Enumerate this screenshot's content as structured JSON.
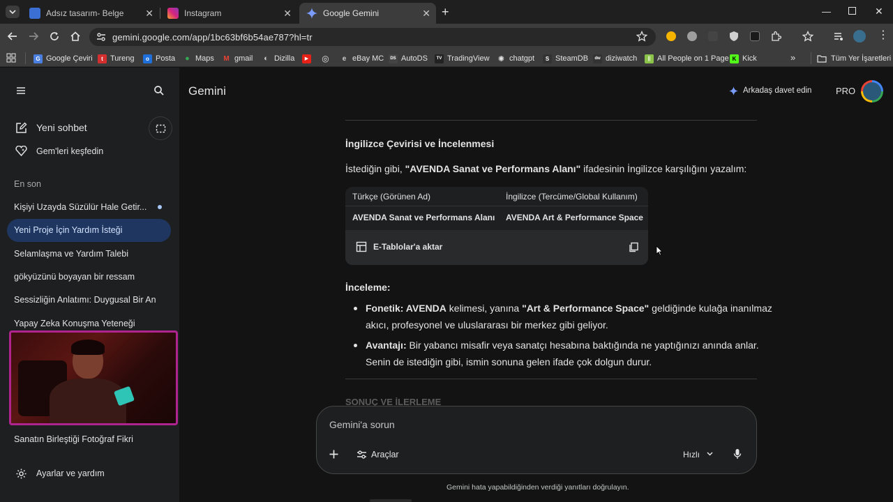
{
  "browser": {
    "tabs": [
      {
        "title": "Adsız tasarım- Belge",
        "fav_color": "#3b6fd4"
      },
      {
        "title": "Instagram",
        "fav_color": "#d6247d"
      },
      {
        "title": "Google Gemini",
        "fav_color": "#6f8ff0"
      }
    ],
    "url": "gemini.google.com/app/1bc63bf6b54ae787?hl=tr",
    "bookmarks": [
      {
        "label": "Google Çeviri",
        "color": "#4a7fe0",
        "glyph": "G"
      },
      {
        "label": "Tureng",
        "color": "#d32f2f",
        "glyph": "t"
      },
      {
        "label": "Posta",
        "color": "#1e6fd9",
        "glyph": "o"
      },
      {
        "label": "Maps",
        "color": "#34a853",
        "glyph": "●"
      },
      {
        "label": "gmail",
        "color": "#ea4335",
        "glyph": "M"
      },
      {
        "label": "Dizilla",
        "color": "#555",
        "glyph": "◐"
      },
      {
        "label": "",
        "color": "#e62117",
        "glyph": "▶"
      },
      {
        "label": "",
        "color": "#444",
        "glyph": "◎"
      },
      {
        "label": "eBay MC",
        "color": "#666",
        "glyph": "e"
      },
      {
        "label": "AutoDS",
        "color": "#444",
        "glyph": "DS"
      },
      {
        "label": "TradingView",
        "color": "#222",
        "glyph": "TV"
      },
      {
        "label": "chatgpt",
        "color": "#555",
        "glyph": "✺"
      },
      {
        "label": "SteamDB",
        "color": "#333",
        "glyph": "S"
      },
      {
        "label": "diziwatch",
        "color": "#333",
        "glyph": "dw"
      },
      {
        "label": "All People on 1 Page",
        "color": "#8bc34a",
        "glyph": "||"
      },
      {
        "label": "Kick",
        "color": "#53fc18",
        "glyph": "K"
      }
    ],
    "all_bookmarks": "Tüm Yer İşaretleri"
  },
  "sidebar": {
    "new_chat": "Yeni sohbet",
    "explore_gems": "Gem'leri keşfedin",
    "recent_heading": "En son",
    "chats": [
      "Kişiyi Uzayda Süzülür Hale Getir...",
      "Yeni Proje İçin Yardım İsteği",
      "Selamlaşma ve Yardım Talebi",
      "gökyüzünü boyayan bir ressam",
      "Sessizliğin Anlatımı: Duygusal Bir An",
      "Yapay Zeka Konuşma Yeteneği"
    ],
    "bottom_chat": "Sanatın Birleştiği Fotoğraf Fikri",
    "settings": "Ayarlar ve yardım"
  },
  "header": {
    "title": "Gemini",
    "invite": "Arkadaş davet edin",
    "plan": "PRO"
  },
  "response": {
    "heading": "İngilizce Çevirisi ve İncelenmesi",
    "intro_pre": "İstediğin gibi, ",
    "intro_bold": "\"AVENDA Sanat ve Performans Alanı\"",
    "intro_post": " ifadesinin İngilizce karşılığını yazalım:",
    "table": {
      "headers": [
        "Türkçe (Görünen Ad)",
        "İngilizce (Tercüme/Global Kullanım)"
      ],
      "row": [
        "AVENDA Sanat ve Performans Alanı",
        "AVENDA Art & Performance Space"
      ],
      "export": "E-Tablolar'a aktar"
    },
    "review_heading": "İnceleme:",
    "bullets": [
      {
        "bold": "Fonetik: AVENDA",
        "text1": " kelimesi, yanına ",
        "bold2": "\"Art & Performance Space\"",
        "text2": " geldiğinde kulağa inanılmaz",
        "line2": "akıcı, profesyonel ve uluslararası bir merkez gibi geliyor."
      },
      {
        "bold": "Avantajı:",
        "text1": " Bir yabancı misafir veya sanatçı hesabına baktığında ne yaptığınızı anında anlar.",
        "line2": "Senin de istediğin gibi, ismin sonuna gelen ifade çok dolgun durur."
      }
    ],
    "next_heading": "SONUÇ VE İLERLEME"
  },
  "input": {
    "placeholder": "Gemini'a sorun",
    "tools": "Araçlar",
    "mode": "Hızlı"
  },
  "disclaimer": "Gemini hata yapabildiğinden verdiği yanıtları doğrulayın."
}
